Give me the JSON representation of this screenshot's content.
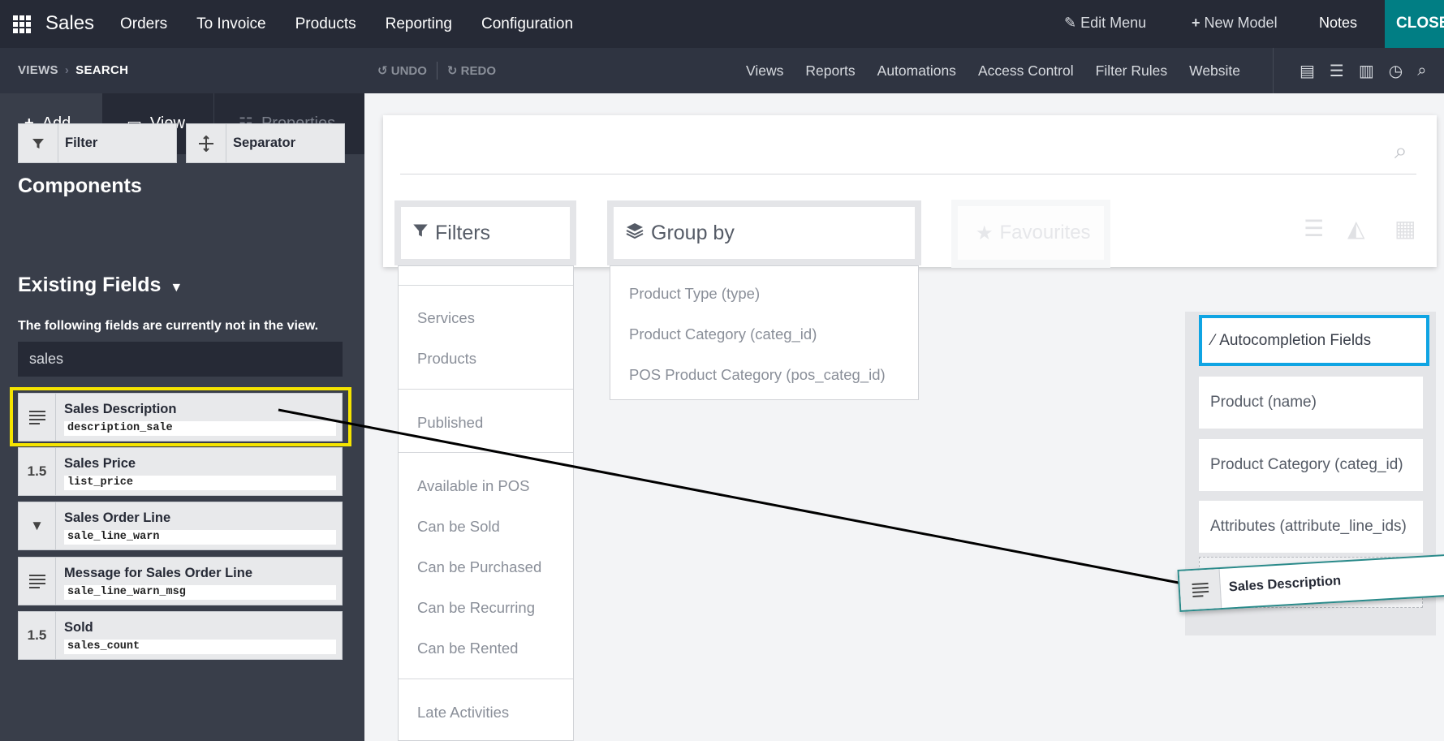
{
  "topbar": {
    "brand": "Sales",
    "menu": [
      "Orders",
      "To Invoice",
      "Products",
      "Reporting",
      "Configuration"
    ],
    "edit_menu": "Edit Menu",
    "new_model": "New Model",
    "notes": "Notes",
    "close": "CLOSE"
  },
  "subbar": {
    "crumb_views": "VIEWS",
    "crumb_search": "SEARCH",
    "undo": "UNDO",
    "redo": "REDO",
    "menu": [
      "Views",
      "Reports",
      "Automations",
      "Access Control",
      "Filter Rules",
      "Website"
    ],
    "icons": [
      "form-view-icon",
      "list-view-icon",
      "kanban-view-icon",
      "history-icon",
      "search-icon"
    ]
  },
  "sidebar": {
    "tabs": {
      "add": "Add",
      "view": "View",
      "properties": "Properties"
    },
    "components_title": "Components",
    "components": {
      "filter": "Filter",
      "separator": "Separator"
    },
    "existing_title": "Existing Fields",
    "existing_desc": "The following fields are currently not in the view.",
    "search_value": "sales",
    "fields": [
      {
        "name": "Sales Description",
        "tech": "description_sale",
        "icon": "text-lines-icon"
      },
      {
        "name": "Sales Price",
        "tech": "list_price",
        "icon": "1.5"
      },
      {
        "name": "Sales Order Line",
        "tech": "sale_line_warn",
        "icon": "caret-down-icon"
      },
      {
        "name": "Message for Sales Order Line",
        "tech": "sale_line_warn_msg",
        "icon": "text-lines-icon"
      },
      {
        "name": "Sold",
        "tech": "sales_count",
        "icon": "1.5"
      }
    ]
  },
  "canvas": {
    "filters_label": "Filters",
    "groupby_label": "Group by",
    "favourites_label": "Favourites",
    "filters": [
      "Services",
      "Products",
      "Published",
      "Available in POS",
      "Can be Sold",
      "Can be Purchased",
      "Can be Recurring",
      "Can be Rented",
      "Late Activities"
    ],
    "groupby": [
      "Product Type (type)",
      "Product Category (categ_id)",
      "POS Product Category (pos_categ_id)"
    ],
    "autocompletion_title": "Autocompletion Fields",
    "autocompletion": [
      "Product (name)",
      "Product Category (categ_id)",
      "Attributes (attribute_line_ids)"
    ],
    "dragging": "Sales Description"
  },
  "colors": {
    "topbar": "#262a36",
    "close": "#017e84",
    "highlight": "#f5e400",
    "selected": "#0fa4e3"
  }
}
